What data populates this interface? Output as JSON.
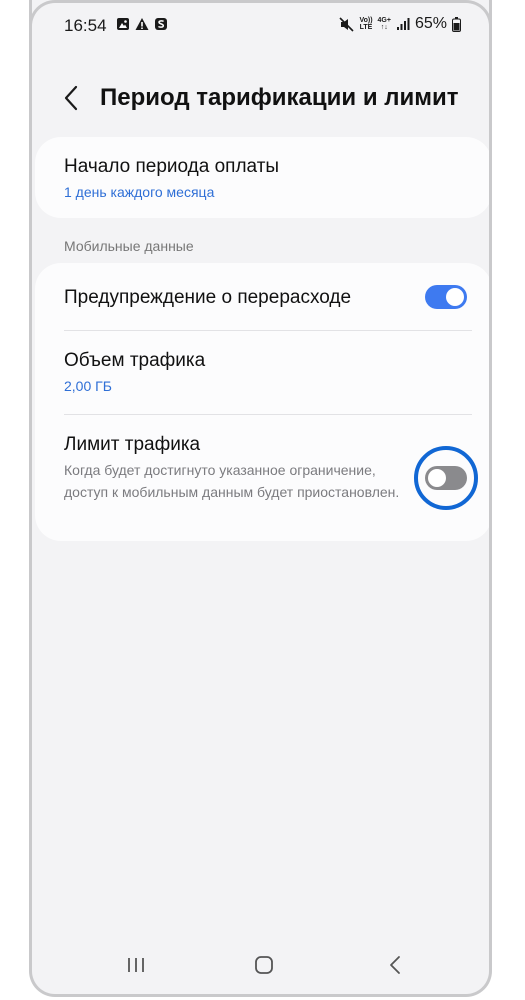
{
  "status_bar": {
    "time": "16:54",
    "left_icons": [
      "gallery-icon",
      "alert-icon",
      "s-app-icon"
    ],
    "right_icons": [
      "mute-icon",
      "volte-icon",
      "4g-icon",
      "signal-icon",
      "battery-icon"
    ],
    "volte_label": [
      "Vo))",
      "LTE"
    ],
    "net_label": [
      "4G+",
      "↑↓"
    ],
    "battery": "65%"
  },
  "header": {
    "back_icon": "chevron-left-icon",
    "title": "Период тарификации и лимит"
  },
  "billing": {
    "title": "Начало периода оплаты",
    "value": "1 день каждого месяца"
  },
  "mobile_data": {
    "section_label": "Мобильные данные",
    "warning": {
      "title": "Предупреждение о перерасходе",
      "enabled": true
    },
    "volume": {
      "title": "Объем трафика",
      "value": "2,00 ГБ"
    },
    "limit": {
      "title": "Лимит трафика",
      "description": "Когда будет достигнуто указанное ограничение, доступ к мобильным данным будет приостановлен.",
      "enabled": false
    }
  },
  "colors": {
    "accent": "#3e7af0",
    "link": "#2f6fd6",
    "highlight": "#1167d4",
    "toggle_off": "#8a8a8d"
  },
  "navbar": {
    "items": [
      "recents-icon",
      "home-icon",
      "back-icon"
    ]
  }
}
